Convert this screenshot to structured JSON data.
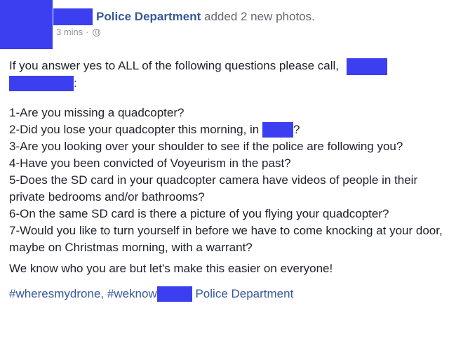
{
  "post": {
    "page_name": "Police Department",
    "action": "added 2 new photos.",
    "timestamp": "3 mins",
    "privacy_separator": "·",
    "intro_text": "If you answer yes to ALL of the following questions please call,",
    "intro_suffix": ":",
    "questions": [
      {
        "pre": "1-Are you missing a quadcopter?"
      },
      {
        "pre": "2-Did you lose your quadcopter this morning, in ",
        "post": "?"
      },
      {
        "pre": "3-Are you looking over your shoulder to see if the police are following you?"
      },
      {
        "pre": "4-Have you been convicted of Voyeurism in the past?"
      },
      {
        "pre": "5-Does the SD card in your quadcopter camera have videos of people in their private bedrooms and/or bathrooms?"
      },
      {
        "pre": "6-On the same SD card is there a picture of you flying your quadcopter?"
      },
      {
        "pre": "7-Would you like to turn yourself in before we have to come knocking at your door, maybe on Christmas morning, with a warrant?"
      }
    ],
    "closing": "We know who you are but let's make this easier on everyone!",
    "hashtag1": "#wheresmydrone,",
    "hashtag2": "#weknow",
    "signature_page": "Police Department"
  },
  "colors": {
    "redaction": "#3b3ff0",
    "link": "#365899",
    "text": "#1d2129",
    "meta": "#90949c"
  },
  "icons": {
    "privacy": "globe-icon"
  }
}
